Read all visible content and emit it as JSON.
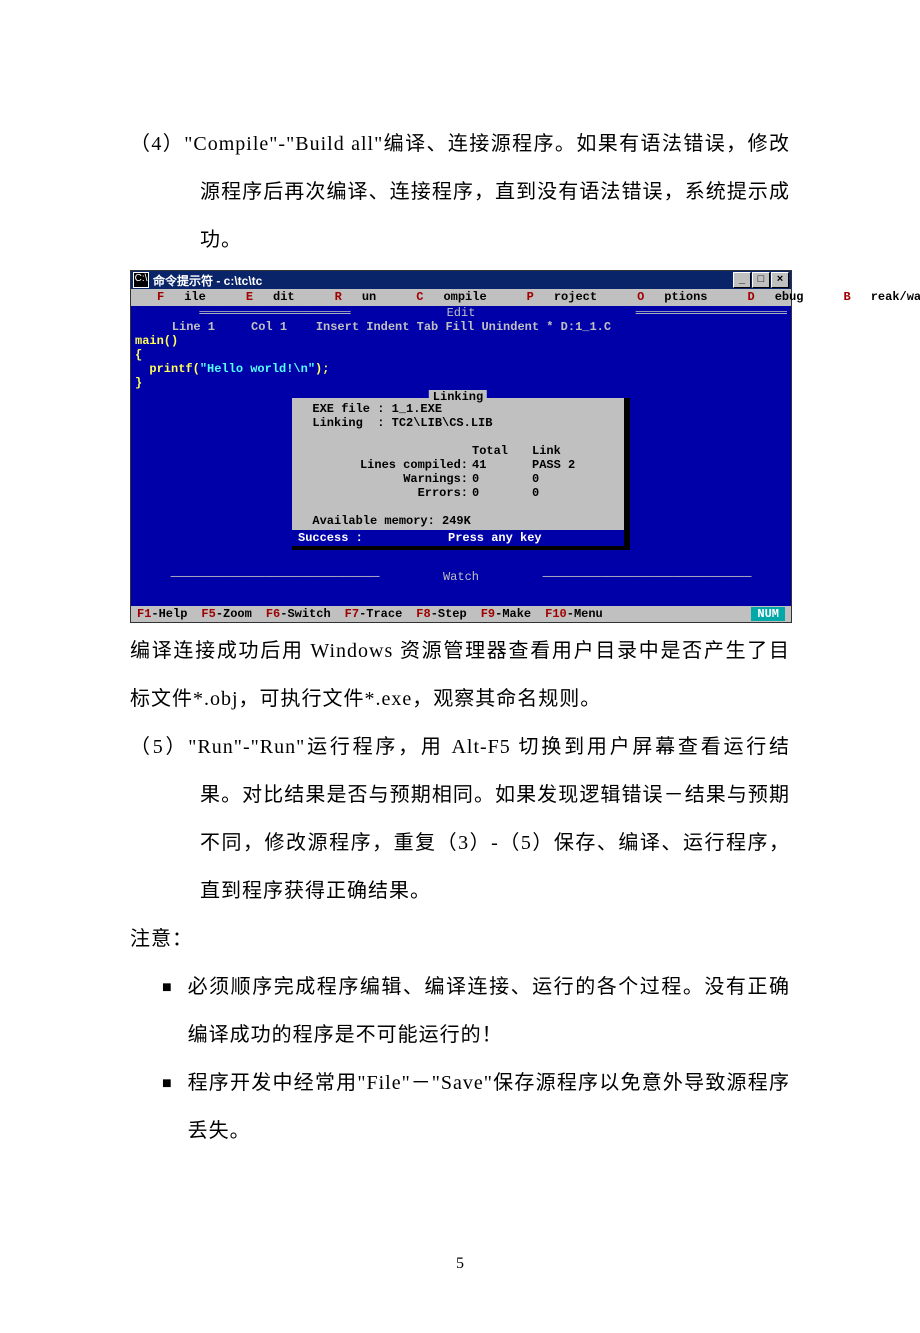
{
  "para1": "（4）\"Compile\"-\"Build all\"编译、连接源程序。如果有语法错误，修改源程序后再次编译、连接程序，直到没有语法错误，系统提示成功。",
  "screenshot": {
    "window_title": "命令提示符 - c:\\tc\\tc",
    "icon_glyph": "C:\\",
    "win_buttons": {
      "min": "_",
      "max": "□",
      "close": "×"
    },
    "menu": [
      {
        "hot": "F",
        "rest": "ile"
      },
      {
        "hot": "E",
        "rest": "dit"
      },
      {
        "hot": "R",
        "rest": "un"
      },
      {
        "hot": "C",
        "rest": "ompile"
      },
      {
        "hot": "P",
        "rest": "roject"
      },
      {
        "hot": "O",
        "rest": "ptions"
      },
      {
        "hot": "D",
        "rest": "ebug"
      },
      {
        "hot": "B",
        "rest": "reak/watch"
      }
    ],
    "edit_label": " Edit ",
    "status": "    Line 1     Col 1    Insert Indent Tab Fill Unindent * D:1_1.C",
    "code": {
      "l1": "main()",
      "l2": "{",
      "l3a": "  printf(",
      "l3b": "\"Hello world!\\n\"",
      "l3c": ");",
      "l4": "}"
    },
    "linking": {
      "title": " Linking ",
      "exe": "  EXE file : 1_1.EXE",
      "lib": "  Linking  : TC2\\LIB\\CS.LIB",
      "hdr_total": "Total",
      "hdr_link": "Link",
      "lines_lbl": "Lines compiled:",
      "lines_total": "41",
      "lines_link": "PASS 2",
      "warn_lbl": "Warnings:",
      "warn_total": "0",
      "warn_link": "0",
      "err_lbl": "Errors:",
      "err_total": "0",
      "err_link": "0",
      "mem": "  Available memory: 249K",
      "success": "Success        :",
      "press": "    Press  any  key"
    },
    "watch_label": " Watch ",
    "fkeys": [
      {
        "hot": "F1",
        "rest": "-Help"
      },
      {
        "hot": "F5",
        "rest": "-Zoom"
      },
      {
        "hot": "F6",
        "rest": "-Switch"
      },
      {
        "hot": "F7",
        "rest": "-Trace"
      },
      {
        "hot": "F8",
        "rest": "-Step"
      },
      {
        "hot": "F9",
        "rest": "-Make"
      },
      {
        "hot": "F10",
        "rest": "-Menu"
      }
    ],
    "num": "NUM"
  },
  "para2": "编译连接成功后用 Windows 资源管理器查看用户目录中是否产生了目标文件*.obj，可执行文件*.exe，观察其命名规则。",
  "para3": "（5）\"Run\"-\"Run\"运行程序，用 Alt-F5 切换到用户屏幕查看运行结果。对比结果是否与预期相同。如果发现逻辑错误－结果与预期不同，修改源程序，重复（3）-（5）保存、编译、运行程序，直到程序获得正确结果。",
  "note_label": "注意：",
  "bullets": [
    "必须顺序完成程序编辑、编译连接、运行的各个过程。没有正确编译成功的程序是不可能运行的！",
    "程序开发中经常用\"File\"－\"Save\"保存源程序以免意外导致源程序丢失。"
  ],
  "page_number": "5"
}
